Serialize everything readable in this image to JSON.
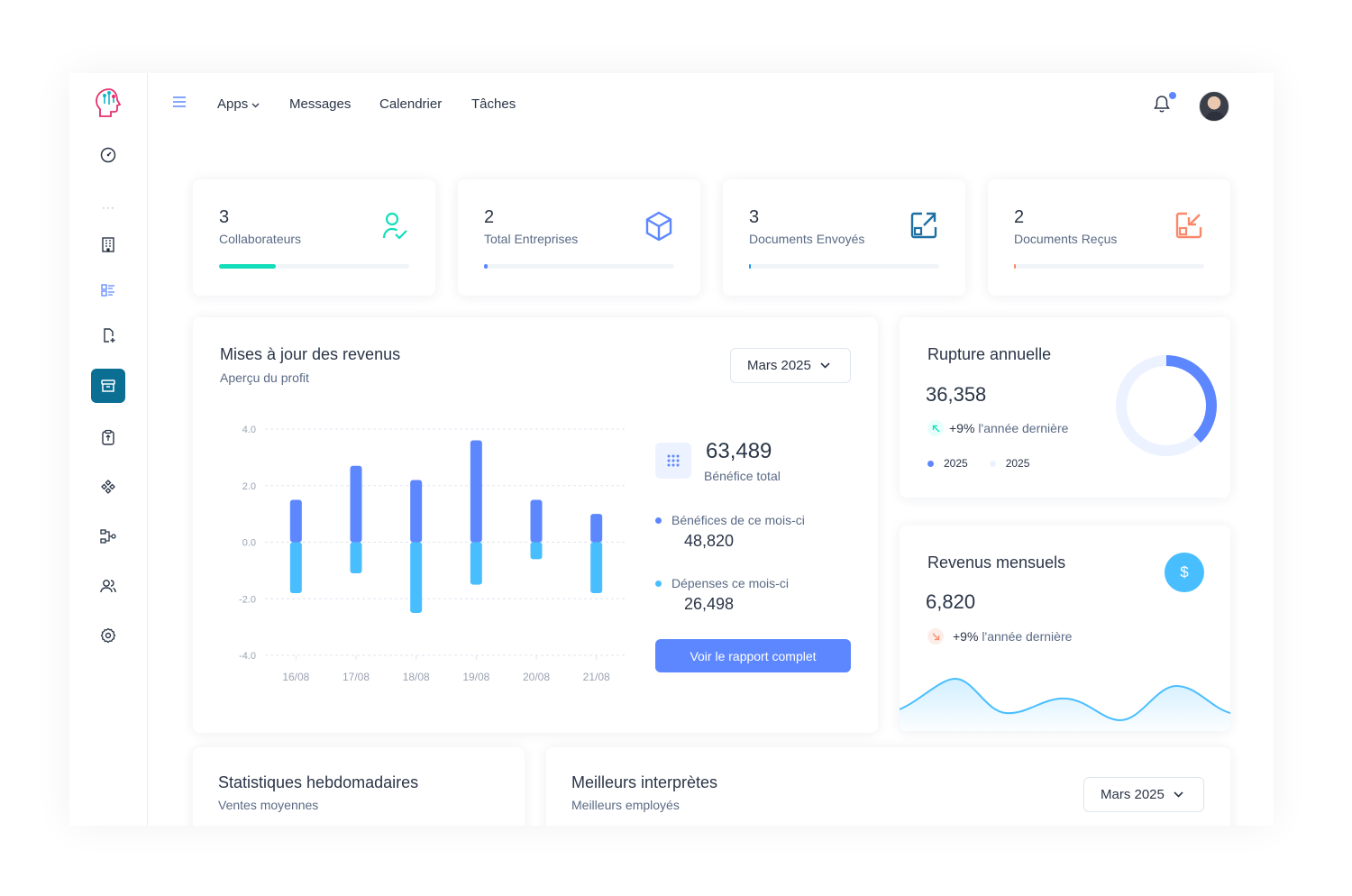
{
  "nav": {
    "apps": "Apps",
    "messages": "Messages",
    "calendar": "Calendrier",
    "tasks": "Tâches"
  },
  "sidebar": {
    "dots": "···"
  },
  "stats": [
    {
      "value": "3",
      "label": "Collaborateurs",
      "progress": 0.3,
      "color": "#13deb9"
    },
    {
      "value": "2",
      "label": "Total Entreprises",
      "progress": 0.02,
      "color": "#5d87ff"
    },
    {
      "value": "3",
      "label": "Documents Envoyés",
      "progress": 0.01,
      "color": "#1a97f5"
    },
    {
      "value": "2",
      "label": "Documents Reçus",
      "progress": 0.005,
      "color": "#fa896b"
    }
  ],
  "revenue": {
    "title": "Mises à jour des revenus",
    "subtitle": "Aperçu du profit",
    "dropdown": "Mars 2025",
    "total_value": "63,489",
    "total_label": "Bénéfice total",
    "profit_label": "Bénéfices de ce mois-ci",
    "profit_value": "48,820",
    "expense_label": "Dépenses ce mois-ci",
    "expense_value": "26,498",
    "button": "Voir le rapport complet"
  },
  "chart_data": {
    "type": "bar",
    "categories": [
      "16/08",
      "17/08",
      "18/08",
      "19/08",
      "20/08",
      "21/08"
    ],
    "series": [
      {
        "values": [
          1.5,
          2.7,
          2.2,
          3.6,
          1.5,
          1.0
        ],
        "color": "#5d87ff"
      },
      {
        "values": [
          -1.8,
          -1.1,
          -2.5,
          -1.5,
          -0.6,
          -1.8
        ],
        "color": "#49beff"
      }
    ],
    "yticks": [
      "4.0",
      "2.0",
      "0.0",
      "-2.0",
      "-4.0"
    ],
    "ylim": [
      -4,
      4
    ],
    "grid": true
  },
  "annual": {
    "title": "Rupture annuelle",
    "value": "36,358",
    "change": "+9%",
    "change_text": "l'année dernière",
    "legend": [
      "2025",
      "2025"
    ],
    "donut_fraction": 0.38,
    "colors": [
      "#5d87ff",
      "#ecf2ff"
    ]
  },
  "monthly": {
    "title": "Revenus mensuels",
    "value": "6,820",
    "change": "+9%",
    "change_text": "l'année dernière",
    "currency_icon": "dollar-icon"
  },
  "weekly": {
    "title": "Statistiques hebdomadaires",
    "subtitle": "Ventes moyennes"
  },
  "performers": {
    "title": "Meilleurs interprètes",
    "subtitle": "Meilleurs employés",
    "dropdown": "Mars 2025"
  }
}
